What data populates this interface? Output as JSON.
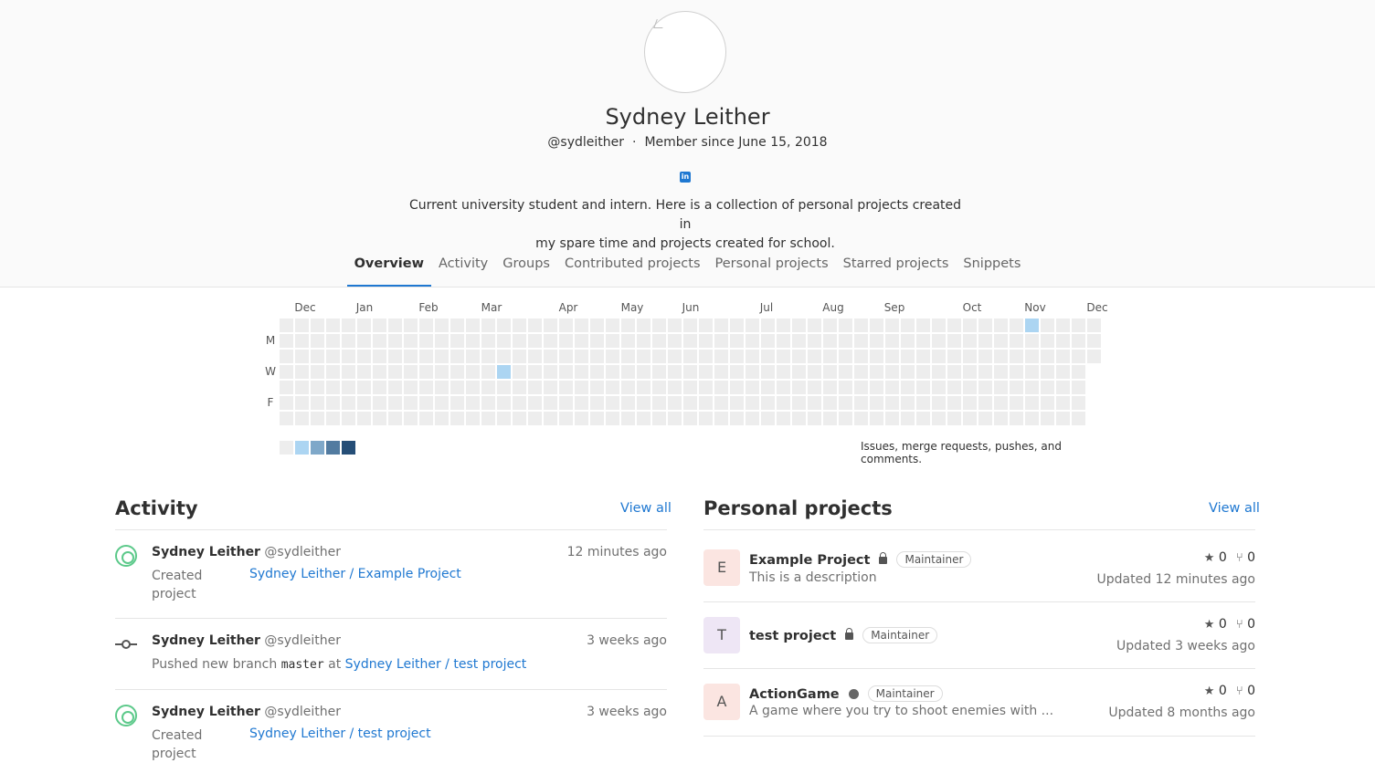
{
  "profile": {
    "name": "Sydney Leither",
    "username": "@sydleither",
    "member_since": "Member since June 15, 2018",
    "bio_line1": "Current university student and intern. Here is a collection of personal projects created in",
    "bio_line2": "my spare time and projects created for school.",
    "social_icon": "linkedin-icon"
  },
  "tabs": [
    {
      "label": "Overview",
      "active": true
    },
    {
      "label": "Activity"
    },
    {
      "label": "Groups"
    },
    {
      "label": "Contributed projects"
    },
    {
      "label": "Personal projects"
    },
    {
      "label": "Starred projects"
    },
    {
      "label": "Snippets"
    }
  ],
  "calendar": {
    "months": [
      "Dec",
      "Jan",
      "Feb",
      "Mar",
      "Apr",
      "May",
      "Jun",
      "Jul",
      "Aug",
      "Sep",
      "Oct",
      "Nov",
      "Dec"
    ],
    "day_labels": [
      "M",
      "W",
      "F"
    ],
    "legend_text": "Issues, merge requests, pushes, and comments.",
    "colors": [
      "#ededed",
      "#acd5f2",
      "#7fa8c9",
      "#527ba0",
      "#254e77"
    ],
    "active_cells": [
      {
        "week": 14,
        "day": 3,
        "level": 1
      },
      {
        "week": 48,
        "day": 0,
        "level": 1
      }
    ]
  },
  "activity": {
    "title": "Activity",
    "view_all": "View all",
    "items": [
      {
        "author": "Sydney Leither",
        "handle": "@sydleither",
        "time": "12 minutes ago",
        "action": "Created",
        "action2": "project",
        "target": "Sydney Leither / Example Project",
        "icon": "created-icon"
      },
      {
        "author": "Sydney Leither",
        "handle": "@sydleither",
        "time": "3 weeks ago",
        "action": "Pushed new branch",
        "branch": "master",
        "at": "at",
        "target": "Sydney Leither / test project",
        "icon": "commit-icon"
      },
      {
        "author": "Sydney Leither",
        "handle": "@sydleither",
        "time": "3 weeks ago",
        "action": "Created",
        "action2": "project",
        "target": "Sydney Leither / test project",
        "icon": "created-icon"
      }
    ]
  },
  "projects": {
    "title": "Personal projects",
    "view_all": "View all",
    "items": [
      {
        "letter": "E",
        "name": "Example Project",
        "visibility": "lock-icon",
        "role": "Maintainer",
        "description": "This is a description",
        "stars": "0",
        "forks": "0",
        "updated": "Updated 12 minutes ago",
        "color": "#fbe5e1"
      },
      {
        "letter": "T",
        "name": "test project",
        "visibility": "lock-icon",
        "role": "Maintainer",
        "description": "",
        "stars": "0",
        "forks": "0",
        "updated": "Updated 3 weeks ago",
        "color": "#eee6f5"
      },
      {
        "letter": "A",
        "name": "ActionGame",
        "visibility": "globe-icon",
        "role": "Maintainer",
        "description": "A game where you try to shoot enemies with ...",
        "stars": "0",
        "forks": "0",
        "updated": "Updated 8 months ago",
        "color": "#fbe5e1"
      }
    ]
  }
}
